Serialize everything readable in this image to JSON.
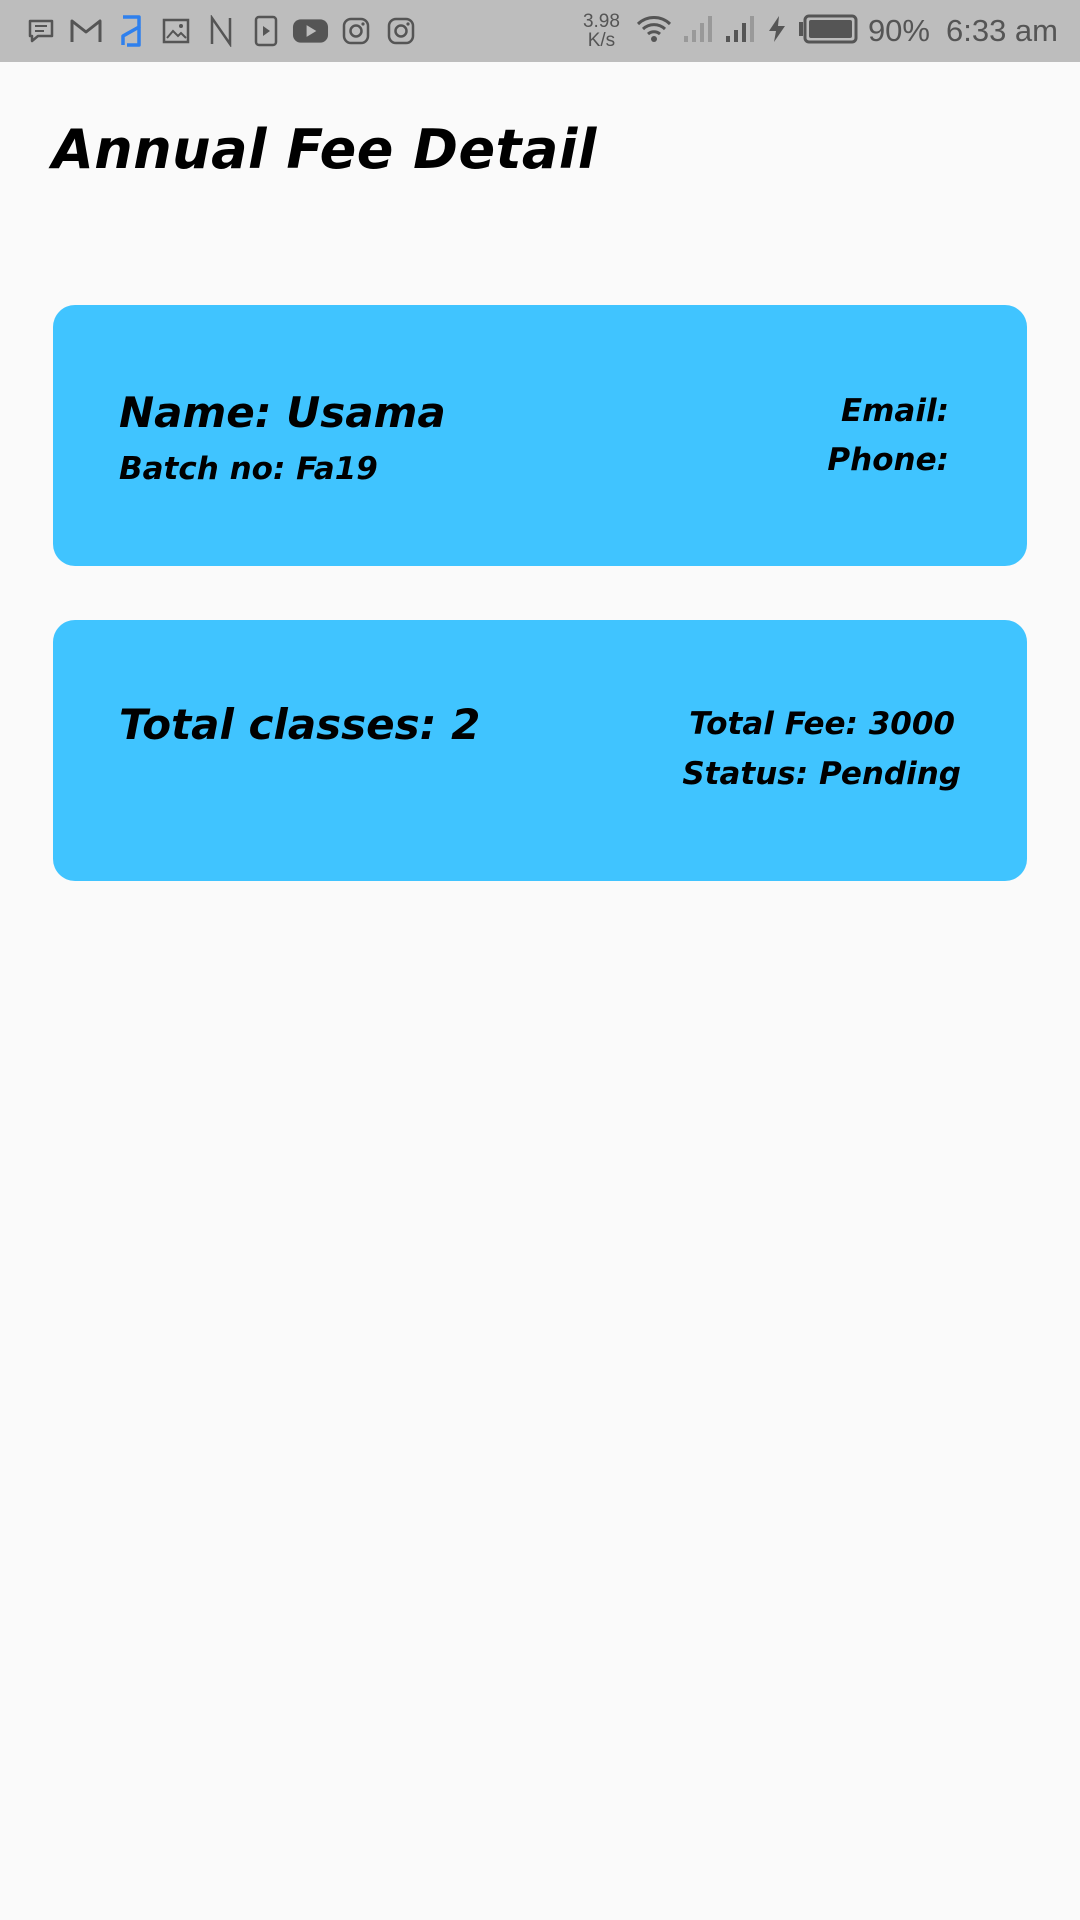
{
  "status_bar": {
    "notification_icons": [
      "message-icon",
      "gmail-icon",
      "app-blue-icon",
      "gallery-icon",
      "n-app-icon",
      "video-player-icon",
      "youtube-icon",
      "instagram-icon",
      "instagram-icon"
    ],
    "net_speed_value": "3.98",
    "net_speed_unit": "K/s",
    "battery_percent": "90%",
    "time": "6:33 am"
  },
  "page": {
    "title": "Annual Fee Detail"
  },
  "student_card": {
    "name": "Name: Usama",
    "batch": "Batch no: Fa19",
    "email": "Email:",
    "phone": "Phone:"
  },
  "fee_card": {
    "total_classes": "Total classes: 2",
    "total_fee": "Total Fee: 3000",
    "status": "Status: Pending"
  },
  "colors": {
    "card_background": "#40c4ff",
    "page_background": "#fafafa",
    "status_bar_background": "#bdbdbd"
  }
}
